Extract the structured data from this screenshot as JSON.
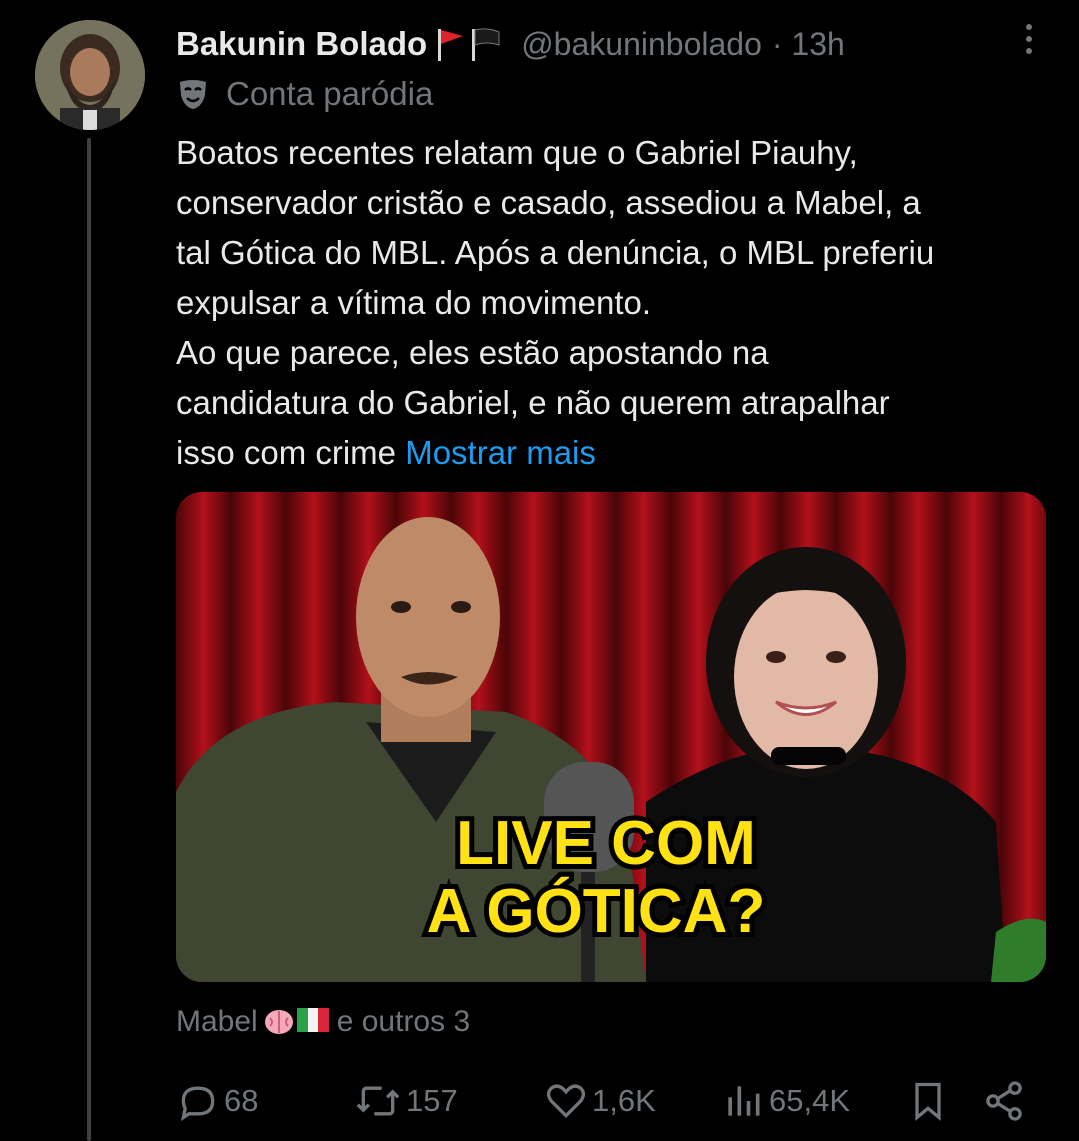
{
  "author": {
    "name": "Bakunin Bolado",
    "handle": "@bakuninbolado",
    "time": "· 13h",
    "badge_label": "Conta paródia",
    "flag_icons": [
      "red-flag-icon",
      "black-flag-icon"
    ]
  },
  "tweet": {
    "lines": [
      "Boatos recentes relatam que o Gabriel Piauhy,",
      "conservador cristão e casado, assediou a Mabel, a",
      "tal Gótica do MBL. Após a denúncia, o MBL preferiu",
      "expulsar a vítima do movimento.",
      "Ao que parece, eles estão apostando na",
      "candidatura do Gabriel, e não querem atrapalhar"
    ],
    "last_line": "isso com crime",
    "show_more": "Mostrar mais"
  },
  "media": {
    "overlay_line1": "LIVE COM",
    "overlay_line2": "A GÓTICA?"
  },
  "liked_by": {
    "name": "Mabel",
    "emoji_icons": [
      "brain-emoji-icon",
      "italy-flag-icon"
    ],
    "suffix": "e outros 3"
  },
  "actions": {
    "replies": "68",
    "reposts": "157",
    "likes": "1,6K",
    "views": "65,4K"
  },
  "colors": {
    "background": "#000000",
    "text": "#e7e9ea",
    "muted": "#71767b",
    "link": "#1d9bf0",
    "overlay_yellow": "#ffe114"
  }
}
